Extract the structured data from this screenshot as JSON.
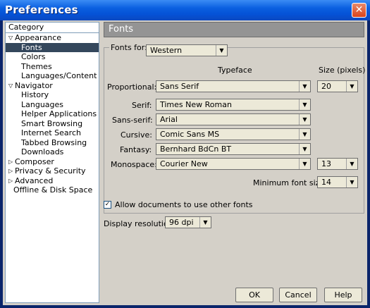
{
  "window": {
    "title": "Preferences",
    "close_glyph": "✕"
  },
  "sidebar": {
    "header": "Category",
    "items": [
      {
        "label": "Appearance",
        "expander": "▽",
        "level": 0
      },
      {
        "label": "Fonts",
        "level": 1,
        "selected": true
      },
      {
        "label": "Colors",
        "level": 1
      },
      {
        "label": "Themes",
        "level": 1
      },
      {
        "label": "Languages/Content",
        "level": 1
      },
      {
        "label": "Navigator",
        "expander": "▽",
        "level": 0
      },
      {
        "label": "History",
        "level": 1
      },
      {
        "label": "Languages",
        "level": 1
      },
      {
        "label": "Helper Applications",
        "level": 1
      },
      {
        "label": "Smart Browsing",
        "level": 1
      },
      {
        "label": "Internet Search",
        "level": 1
      },
      {
        "label": "Tabbed Browsing",
        "level": 1
      },
      {
        "label": "Downloads",
        "level": 1
      },
      {
        "label": "Composer",
        "expander": "▷",
        "level": 0
      },
      {
        "label": "Privacy & Security",
        "expander": "▷",
        "level": 0
      },
      {
        "label": "Advanced",
        "expander": "▷",
        "level": 0
      },
      {
        "label": "Offline & Disk Space",
        "level": 0
      }
    ]
  },
  "panel": {
    "title": "Fonts",
    "fonts_for_label": "Fonts for:",
    "fonts_for_value": "Western",
    "col_typeface": "Typeface",
    "col_size": "Size (pixels)",
    "rows": {
      "proportional": {
        "label": "Proportional:",
        "value": "Sans Serif",
        "size": "20"
      },
      "serif": {
        "label": "Serif:",
        "value": "Times New Roman"
      },
      "sansserif": {
        "label": "Sans-serif:",
        "value": "Arial"
      },
      "cursive": {
        "label": "Cursive:",
        "value": "Comic Sans MS"
      },
      "fantasy": {
        "label": "Fantasy:",
        "value": "Bernhard BdCn BT"
      },
      "monospace": {
        "label": "Monospace:",
        "value": "Courier New",
        "size": "13"
      }
    },
    "min_size_label": "Minimum font size:",
    "min_size_value": "14",
    "allow_docs_label": "Allow documents to use other fonts",
    "allow_docs_checked": true,
    "resolution_label": "Display resolution:",
    "resolution_value": "96 dpi"
  },
  "buttons": {
    "ok": "OK",
    "cancel": "Cancel",
    "help": "Help"
  }
}
